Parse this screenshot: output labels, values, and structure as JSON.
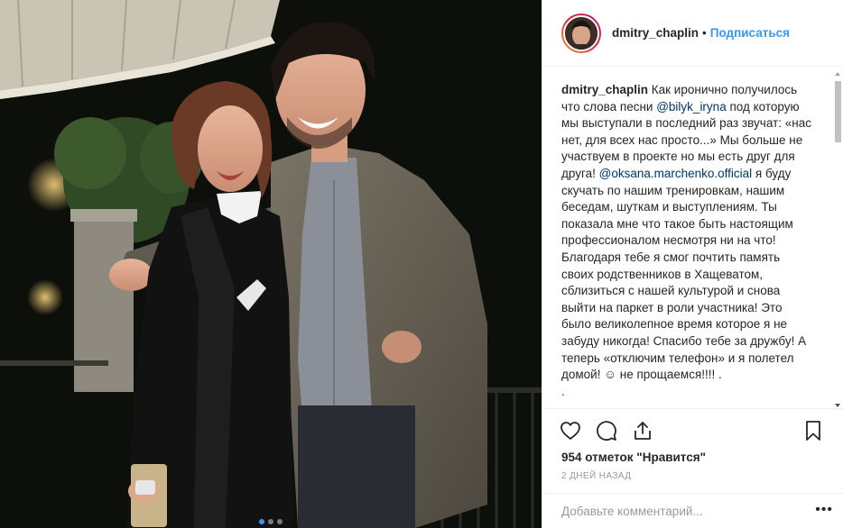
{
  "post": {
    "username": "dmitry_chaplin",
    "separator": "•",
    "follow_label": "Подписаться",
    "caption": {
      "username": "dmitry_chaplin",
      "part1": " Как иронично получилось что слова песни ",
      "mention1": "@bilyk_iryna",
      "part2": " под которую мы выступали в последний раз звучат: «нас нет, для всех нас просто...» Мы больше не участвуем в проекте но мы есть друг для друга! ",
      "mention2": "@oksana.marchenko.official",
      "part3": " я буду скучать по нашим тренировкам, нашим беседам, шуткам и выступлениям. Ты показала мне что такое быть настоящим профессионалом несмотря ни на что! Благодаря тебе я смог почтить память своих родственников в Хащеватом, сблизиться с нашей культурой и снова выйти на паркет в роли участника! Это было великолепное время которое я не забуду никогда! Спасибо тебе за дружбу! А теперь «отключим телефон» и я полетел домой! ☺ не прощаемся!!!! .",
      "trailing": "."
    },
    "likes": "954 отметок \"Нравится\"",
    "time": "2 дней назад",
    "comment_placeholder": "Добавьте комментарий...",
    "more_label": "•••",
    "carousel": {
      "count": 3,
      "active": 0
    }
  },
  "icons": {
    "like": "heart-icon",
    "comment": "comment-icon",
    "share": "share-icon",
    "save": "bookmark-icon"
  },
  "colors": {
    "link": "#3897f0",
    "mention": "#003569",
    "muted": "#999999",
    "text": "#262626"
  }
}
